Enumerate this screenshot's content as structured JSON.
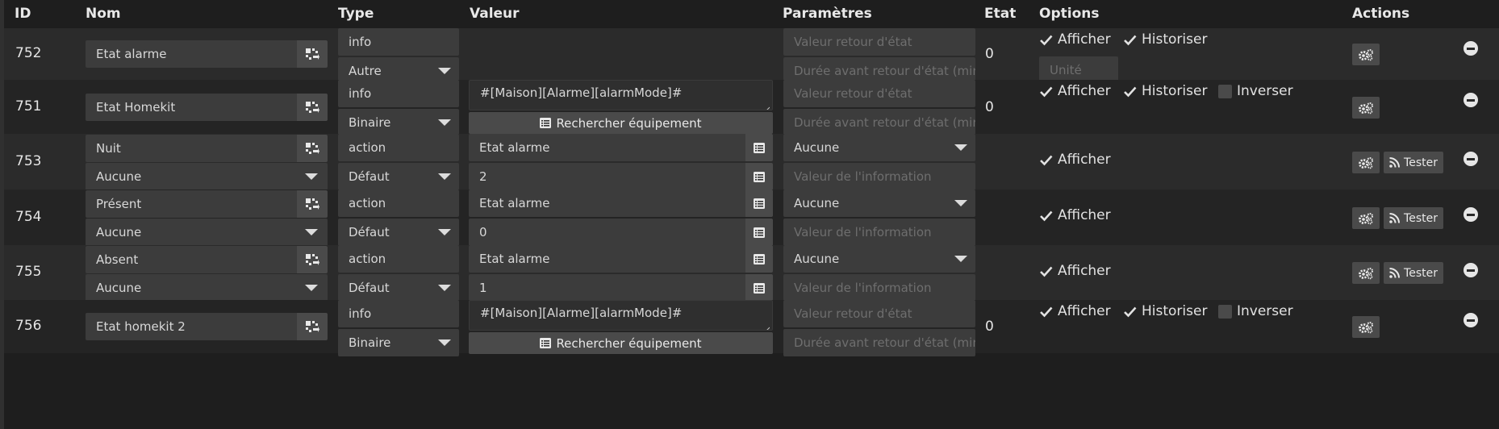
{
  "headers": {
    "id": "ID",
    "nom": "Nom",
    "type": "Type",
    "valeur": "Valeur",
    "parametres": "Paramètres",
    "etat": "Etat",
    "options": "Options",
    "actions": "Actions"
  },
  "labels": {
    "afficher": "Afficher",
    "historiser": "Historiser",
    "inverser": "Inverser",
    "tester": "Tester",
    "rechercher": "Rechercher équipement"
  },
  "placeholders": {
    "valeur_retour": "Valeur retour d'état",
    "duree_retour": "Durée avant retour d'état (min)",
    "unite": "Unité",
    "valeur_info": "Valeur de l'information"
  },
  "rows": [
    {
      "id": "752",
      "name": "Etat alarme",
      "type": "info",
      "subtype": "Autre",
      "etat": "0",
      "afficher": true,
      "historiser": true
    },
    {
      "id": "751",
      "name": "Etat Homekit",
      "type": "info",
      "subtype": "Binaire",
      "value": "#[Maison][Alarme][alarmMode]#",
      "etat": "0",
      "afficher": true,
      "historiser": true,
      "inverser": false
    },
    {
      "id": "753",
      "name": "Nuit",
      "name_sub": "Aucune",
      "type": "action",
      "subtype": "Défaut",
      "value1": "Etat alarme",
      "value2": "2",
      "param_select": "Aucune",
      "afficher": true
    },
    {
      "id": "754",
      "name": "Présent",
      "name_sub": "Aucune",
      "type": "action",
      "subtype": "Défaut",
      "value1": "Etat alarme",
      "value2": "0",
      "param_select": "Aucune",
      "afficher": true
    },
    {
      "id": "755",
      "name": "Absent",
      "name_sub": "Aucune",
      "type": "action",
      "subtype": "Défaut",
      "value1": "Etat alarme",
      "value2": "1",
      "param_select": "Aucune",
      "afficher": true
    },
    {
      "id": "756",
      "name": "Etat homekit 2",
      "type": "info",
      "subtype": "Binaire",
      "value": "#[Maison][Alarme][alarmMode]#",
      "etat": "0",
      "afficher": true,
      "historiser": true,
      "inverser": false
    }
  ]
}
